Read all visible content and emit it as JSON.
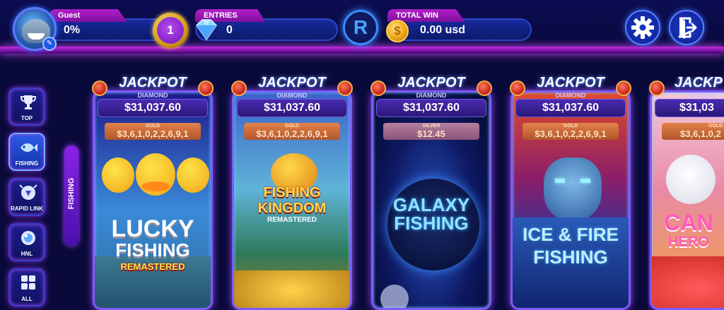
{
  "header": {
    "player_name": "Guest",
    "progress_percent": "0%",
    "progress_value": 0,
    "level": "1",
    "entries_label": "ENTRIES",
    "entries_value": "0",
    "r_button_label": "R",
    "total_win_label": "TOTAL WIN",
    "coin_symbol": "$",
    "total_win_value": "0.00 usd"
  },
  "sidebar": {
    "items": [
      {
        "label": "TOP",
        "icon": "trophy-icon",
        "active": false
      },
      {
        "label": "FISHING",
        "icon": "fish-icon",
        "active": true
      },
      {
        "label": "RAPID LINK",
        "icon": "rapid-link-icon",
        "active": false
      },
      {
        "label": "HNL",
        "icon": "hnl-icon",
        "active": false
      },
      {
        "label": "ALL",
        "icon": "grid-icon",
        "active": false
      }
    ],
    "category_tab": "FISHING"
  },
  "games": [
    {
      "jackpot_label": "JACKPOT",
      "diamond_label": "DIAMOND",
      "diamond_value": "$31,037.60",
      "tier_label": "GOLD",
      "tier_value": "$3,6,1,0,2,2,6,9,1",
      "title_line1": "LUCKY",
      "title_line2": "FISHING",
      "title_line3": "REMASTERED"
    },
    {
      "jackpot_label": "JACKPOT",
      "diamond_label": "DIAMOND",
      "diamond_value": "$31,037.60",
      "tier_label": "GOLD",
      "tier_value": "$3,6,1,0,2,2,6,9,1",
      "title_line1": "FISHING",
      "title_line2": "KINGDOM",
      "title_line3": "REMASTERED"
    },
    {
      "jackpot_label": "JACKPOT",
      "diamond_label": "DIAMOND",
      "diamond_value": "$31,037.60",
      "tier_label": "SILVER",
      "tier_value": "$12.45",
      "title_line1": "GALAXY",
      "title_line2": "FISHING",
      "title_line3": ""
    },
    {
      "jackpot_label": "JACKPOT",
      "diamond_label": "DIAMOND",
      "diamond_value": "$31,037.60",
      "tier_label": "GOLD",
      "tier_value": "$3,6,1,0,2,2,6,9,1",
      "title_line1": "ICE & FIRE",
      "title_line2": "FISHING",
      "title_line3": ""
    },
    {
      "jackpot_label": "JACKP",
      "diamond_label": "DIAMON",
      "diamond_value": "$31,03",
      "tier_label": "GOLD",
      "tier_value": "$3,6,1,0,2",
      "title_line1": "CAN",
      "title_line2": "HERO",
      "title_line3": ""
    }
  ],
  "colors": {
    "accent_purple": "#b21fc8",
    "accent_blue": "#3a8bff",
    "background": "#0a0a3a"
  }
}
